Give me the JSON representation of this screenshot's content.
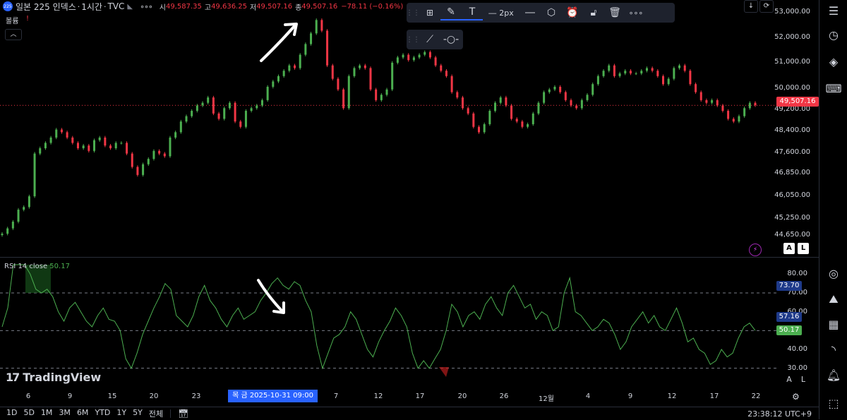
{
  "header": {
    "badge": "225",
    "symbol": "일본 225 인덱스",
    "interval": "1시간",
    "source": "TVC",
    "sep": "·",
    "ohlc": [
      {
        "label": "시",
        "value": "49,587.35"
      },
      {
        "label": "고",
        "value": "49,636.25"
      },
      {
        "label": "저",
        "value": "49,507.16"
      },
      {
        "label": "종",
        "value": "49,507.16"
      }
    ],
    "change": "−78.11 (−0.16%)"
  },
  "volume": {
    "label": "볼륨",
    "warn": "!"
  },
  "toolbar": {
    "width_label": "2px"
  },
  "price_axis": {
    "labels": [
      "53,000.00",
      "52,000.00",
      "51,000.00",
      "50,000.00",
      "49,200.00",
      "48,400.00",
      "47,600.00",
      "46,850.00",
      "46,050.00",
      "45,250.00",
      "44,650.00"
    ],
    "current": "49,507.16"
  },
  "rsi": {
    "name": "RSI",
    "params": "14 close",
    "value": "50.17",
    "axis": [
      "80.00",
      "70.00",
      "60.00",
      "40.00",
      "30.00"
    ],
    "label_upper": "73.70",
    "label_mid": "57.16",
    "label_cur": "50.17"
  },
  "time_axis": {
    "ticks": [
      "6",
      "9",
      "15",
      "20",
      "23",
      "7",
      "12",
      "17",
      "20",
      "26",
      "12월",
      "4",
      "9",
      "12",
      "17",
      "22"
    ],
    "crosshair": "목   금 2025-10-31   09:00"
  },
  "bottom": {
    "ranges": [
      "1D",
      "5D",
      "1M",
      "3M",
      "6M",
      "YTD",
      "1Y",
      "5Y",
      "전체"
    ],
    "clock": "23:38:12 UTC+9"
  },
  "logo": {
    "text": "TradingView"
  },
  "scale_buttons": {
    "a": "A",
    "l": "L"
  },
  "colors": {
    "up": "#4caf50",
    "down": "#f23645",
    "accent": "#2962ff",
    "rsi": "#4caf50"
  },
  "chart_data": {
    "type": "line",
    "price_close": [
      44700,
      44900,
      45150,
      45600,
      45700,
      46100,
      47700,
      47900,
      48100,
      48300,
      48600,
      48500,
      48300,
      48100,
      47900,
      48000,
      47800,
      48200,
      48300,
      48000,
      47900,
      48100,
      48100,
      47700,
      47200,
      46900,
      47300,
      47500,
      47800,
      47700,
      47600,
      48300,
      48500,
      48900,
      49100,
      49300,
      49500,
      49600,
      49800,
      49200,
      49000,
      49400,
      49600,
      48900,
      48700,
      49300,
      49400,
      49500,
      49700,
      50200,
      50400,
      50600,
      50800,
      51000,
      50900,
      51400,
      51800,
      52200,
      52700,
      52300,
      51000,
      50500,
      50100,
      49400,
      50600,
      50900,
      51000,
      50900,
      50100,
      49700,
      49900,
      50100,
      51100,
      51300,
      51400,
      51200,
      51300,
      51400,
      51500,
      51300,
      51000,
      50800,
      50600,
      50000,
      49800,
      49400,
      49200,
      48700,
      48500,
      48800,
      49300,
      49600,
      49800,
      49500,
      49000,
      48900,
      48700,
      48800,
      49200,
      49600,
      50000,
      50100,
      50200,
      50000,
      49700,
      49500,
      49400,
      49700,
      49900,
      50300,
      50600,
      50800,
      51000,
      50600,
      50700,
      50800,
      50700,
      50700,
      50800,
      50900,
      50800,
      50600,
      50300,
      50500,
      50900,
      51000,
      50800,
      50300,
      50000,
      49700,
      49600,
      49700,
      49500,
      49300,
      49000,
      48900,
      49100,
      49400,
      49600,
      49507
    ],
    "rsi": [
      52,
      62,
      85,
      85,
      85,
      80,
      72,
      70,
      72,
      68,
      60,
      55,
      62,
      65,
      60,
      55,
      52,
      58,
      62,
      56,
      55,
      50,
      35,
      30,
      38,
      48,
      55,
      62,
      68,
      75,
      72,
      58,
      55,
      52,
      58,
      68,
      74,
      66,
      62,
      56,
      52,
      58,
      62,
      56,
      58,
      60,
      66,
      70,
      75,
      78,
      74,
      72,
      76,
      74,
      66,
      60,
      42,
      30,
      38,
      46,
      48,
      52,
      60,
      56,
      48,
      40,
      36,
      44,
      50,
      55,
      62,
      58,
      52,
      38,
      30,
      34,
      30,
      35,
      40,
      50,
      64,
      60,
      52,
      58,
      60,
      56,
      64,
      68,
      62,
      58,
      70,
      74,
      68,
      62,
      64,
      56,
      60,
      58,
      50,
      52,
      70,
      78,
      60,
      58,
      54,
      50,
      52,
      56,
      54,
      48,
      40,
      44,
      52,
      56,
      60,
      54,
      58,
      52,
      50,
      56,
      62,
      54,
      44,
      46,
      40,
      38,
      32,
      34,
      40,
      36,
      38,
      46,
      52,
      54,
      50
    ]
  }
}
